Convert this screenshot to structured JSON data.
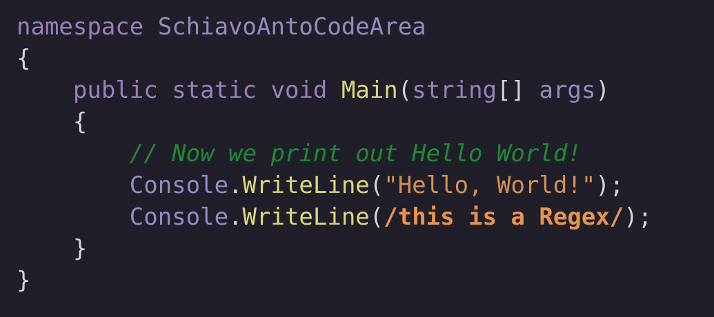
{
  "editor": {
    "lines": [
      {
        "indent": "",
        "tokens": [
          {
            "text": "namespace",
            "kind": "kw"
          },
          {
            "text": " ",
            "kind": "ws"
          },
          {
            "text": "SchiavoAntoCodeArea",
            "kind": "ident"
          }
        ]
      },
      {
        "indent": "",
        "tokens": [
          {
            "text": "{",
            "kind": "punct"
          }
        ]
      },
      {
        "indent": "    ",
        "tokens": [
          {
            "text": "public",
            "kind": "kw"
          },
          {
            "text": " ",
            "kind": "ws"
          },
          {
            "text": "static",
            "kind": "kw"
          },
          {
            "text": " ",
            "kind": "ws"
          },
          {
            "text": "void",
            "kind": "kw"
          },
          {
            "text": " ",
            "kind": "ws"
          },
          {
            "text": "Main",
            "kind": "fn"
          },
          {
            "text": "(",
            "kind": "punct"
          },
          {
            "text": "string",
            "kind": "type"
          },
          {
            "text": "[]",
            "kind": "punct"
          },
          {
            "text": " ",
            "kind": "ws"
          },
          {
            "text": "args",
            "kind": "ident"
          },
          {
            "text": ")",
            "kind": "punct"
          }
        ]
      },
      {
        "indent": "    ",
        "tokens": [
          {
            "text": "{",
            "kind": "punct"
          }
        ]
      },
      {
        "indent": "        ",
        "tokens": [
          {
            "text": "// Now we print out Hello World!",
            "kind": "comment"
          }
        ]
      },
      {
        "indent": "        ",
        "tokens": [
          {
            "text": "Console",
            "kind": "ident"
          },
          {
            "text": ".",
            "kind": "punct"
          },
          {
            "text": "WriteLine",
            "kind": "fn"
          },
          {
            "text": "(",
            "kind": "punct"
          },
          {
            "text": "\"Hello, World!\"",
            "kind": "str"
          },
          {
            "text": ");",
            "kind": "punct"
          }
        ]
      },
      {
        "indent": "        ",
        "tokens": [
          {
            "text": "Console",
            "kind": "ident"
          },
          {
            "text": ".",
            "kind": "punct"
          },
          {
            "text": "WriteLine",
            "kind": "fn"
          },
          {
            "text": "(",
            "kind": "punct"
          },
          {
            "text": "/this is a Regex/",
            "kind": "regex"
          },
          {
            "text": ");",
            "kind": "punct"
          }
        ]
      },
      {
        "indent": "    ",
        "tokens": [
          {
            "text": "}",
            "kind": "punct"
          }
        ]
      },
      {
        "indent": "",
        "tokens": [
          {
            "text": "}",
            "kind": "punct"
          }
        ]
      }
    ]
  },
  "colors": {
    "background": "#201f29",
    "keyword": "#9b7fc0",
    "identifier": "#9a88c5",
    "function": "#dfd67f",
    "punctuation": "#d2d4dc",
    "comment": "#1f8a35",
    "string": "#d69055",
    "regex": "#e8944d"
  }
}
